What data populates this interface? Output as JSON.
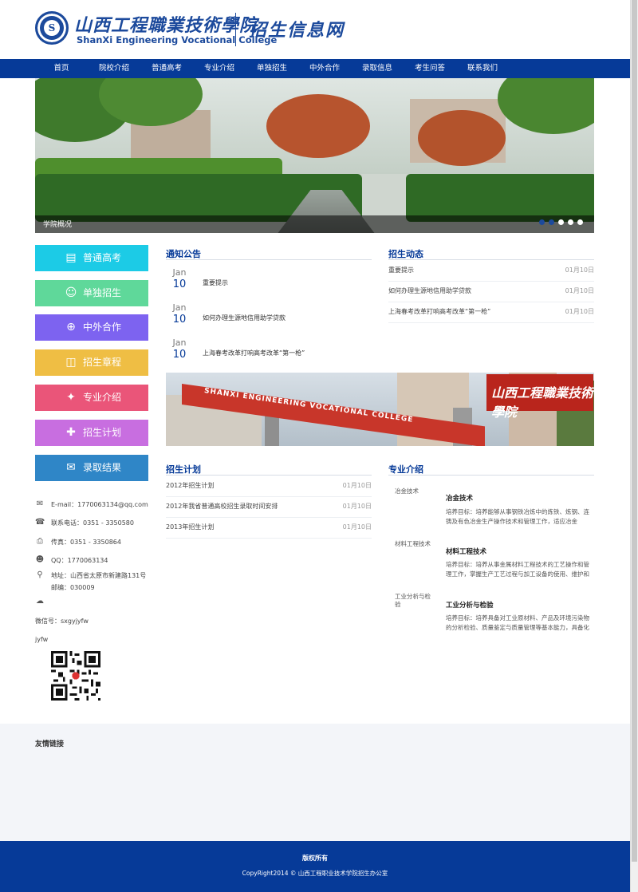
{
  "header": {
    "college_cn": "山西工程職業技術學院",
    "college_en": "ShanXi Engineering Vocational College",
    "site_name": "招生信息网"
  },
  "nav": {
    "items": [
      {
        "label": "首页"
      },
      {
        "label": "院校介绍"
      },
      {
        "label": "普通高考"
      },
      {
        "label": "专业介绍"
      },
      {
        "label": "单独招生"
      },
      {
        "label": "中外合作"
      },
      {
        "label": "录取信息"
      },
      {
        "label": "考生问答"
      },
      {
        "label": "联系我们"
      }
    ]
  },
  "banner": {
    "caption": "学院概况",
    "slide_count": 5,
    "active_slide": 1
  },
  "sidebar": {
    "buttons": [
      {
        "label": "普通高考",
        "icon": "book-icon",
        "color": "#1ccbe6"
      },
      {
        "label": "单独招生",
        "icon": "user-icon",
        "color": "#5fd89a"
      },
      {
        "label": "中外合作",
        "icon": "globe-icon",
        "color": "#7d63f0"
      },
      {
        "label": "招生章程",
        "icon": "document-icon",
        "color": "#efbe44"
      },
      {
        "label": "专业介绍",
        "icon": "pin-icon",
        "color": "#ea5579"
      },
      {
        "label": "招生计划",
        "icon": "tag-icon",
        "color": "#c86ee0"
      },
      {
        "label": "录取结果",
        "icon": "mail-icon",
        "color": "#2f86c7"
      }
    ]
  },
  "contact": {
    "email": "E-mail：1770063134@qq.com",
    "phone": "联系电话：0351 - 3350580",
    "fax": "传真：0351 - 3350864",
    "qq": "QQ：1770063134",
    "address": "地址：山西省太原市新建路131号",
    "postcode": "邮编：030009",
    "wechat": "微信号：sxgyjyfw",
    "wechat_id": "jyfw"
  },
  "notices": {
    "title": "通知公告",
    "items": [
      {
        "month": "Jan",
        "day": "10",
        "title": "重要提示"
      },
      {
        "month": "Jan",
        "day": "10",
        "title": "如何办理生源地信用助学贷款"
      },
      {
        "month": "Jan",
        "day": "10",
        "title": "上海春考改革打响高考改革“第一枪”"
      }
    ]
  },
  "news": {
    "title": "招生动态",
    "items": [
      {
        "title": "重要提示",
        "date": "01月10日"
      },
      {
        "title": "如何办理生源地信用助学贷款",
        "date": "01月10日"
      },
      {
        "title": "上海春考改革打响高考改革“第一枪”",
        "date": "01月10日"
      }
    ]
  },
  "photo": {
    "gate_text": "SHANXI ENGINEERING VOCATIONAL COLLEGE",
    "gate_cn": "山西工程職業技術學院"
  },
  "plans": {
    "title": "招生计划",
    "items": [
      {
        "title": "2012年招生计划",
        "date": "01月10日"
      },
      {
        "title": "2012年我省普通高校招生录取时间安排",
        "date": "01月10日"
      },
      {
        "title": "2013年招生计划",
        "date": "01月10日"
      }
    ]
  },
  "majors": {
    "title": "专业介绍",
    "items": [
      {
        "img_alt": "冶金技术",
        "name": "冶金技术",
        "desc": "培养目标：培养能够从事钢铁冶炼中的炼铁、炼钢、连铸及有色冶金生产操作技术和管理工作，适应冶金"
      },
      {
        "img_alt": "材料工程技术",
        "name": "材料工程技术",
        "desc": "培养目标：培养从事金属材料工程技术的工艺操作和管理工作，掌握生产工艺过程与加工设备的使用、维护和检"
      },
      {
        "img_alt": "工业分析与检验",
        "name": "工业分析与检验",
        "desc": "培养目标：培养具备对工业原材料、产品及环境污染物的分析检验、质量鉴定与质量管理等基本能力，具备化学"
      }
    ]
  },
  "friends": {
    "title": "友情链接"
  },
  "footer": {
    "rights": "版权所有",
    "copyright": "CopyRight2014 © 山西工程职业技术学院招生办公室"
  }
}
